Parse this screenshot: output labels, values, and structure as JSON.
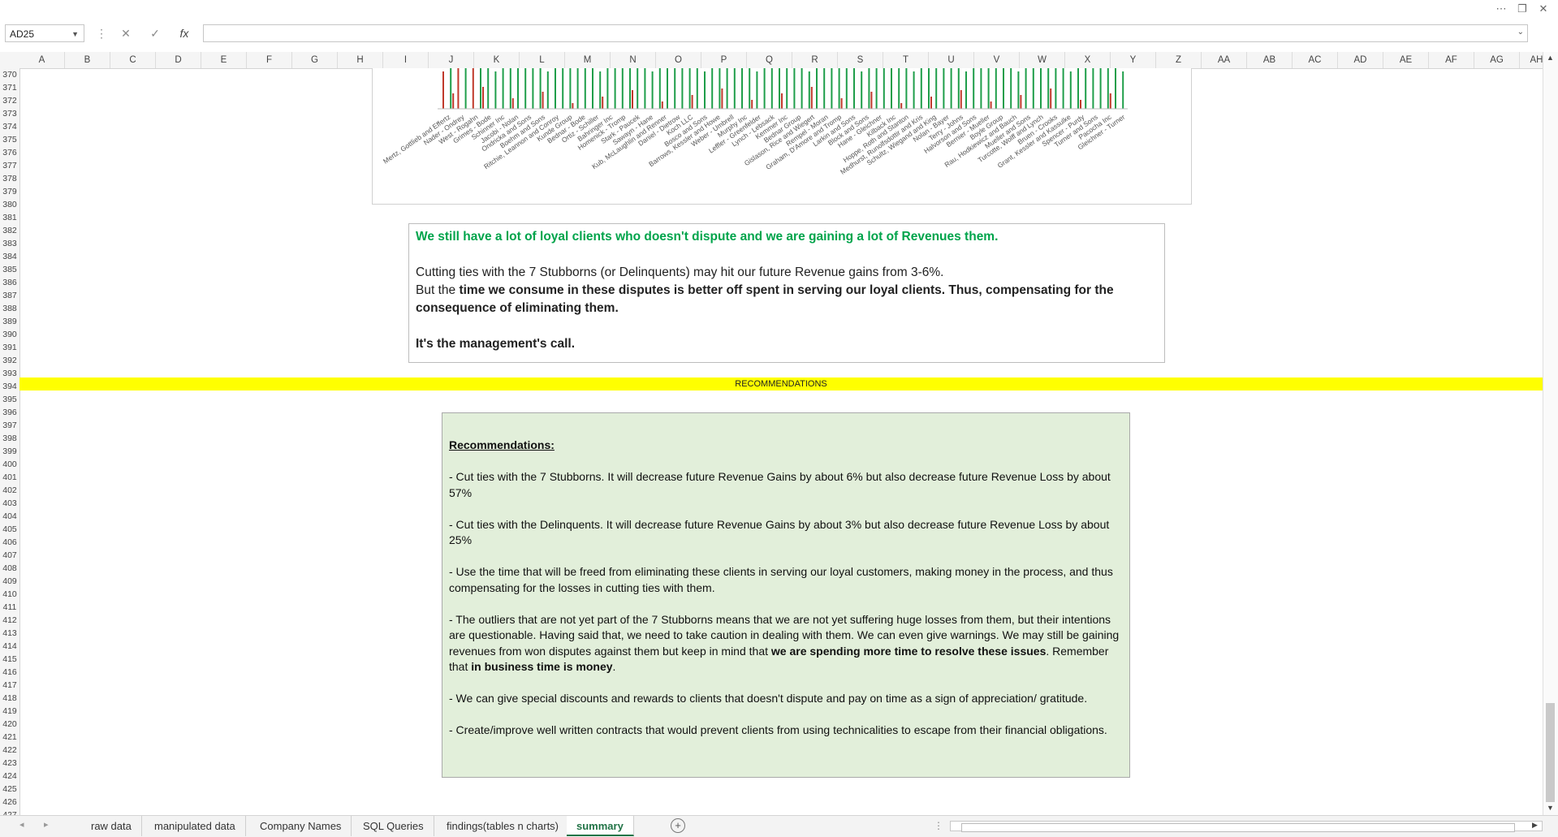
{
  "window": {
    "more_icon": "ellipsis-icon",
    "restore_icon": "restore-icon",
    "close_icon": "close-icon"
  },
  "formula_bar": {
    "name_box": "AD25",
    "formula": ""
  },
  "columns": [
    "A",
    "B",
    "C",
    "D",
    "E",
    "F",
    "G",
    "H",
    "I",
    "J",
    "K",
    "L",
    "M",
    "N",
    "O",
    "P",
    "Q",
    "R",
    "S",
    "T",
    "U",
    "V",
    "W",
    "X",
    "Y",
    "Z",
    "AA",
    "AB",
    "AC",
    "AD",
    "AE",
    "AF",
    "AG",
    "AH"
  ],
  "rows": [
    "370",
    "371",
    "372",
    "373",
    "374",
    "375",
    "376",
    "377",
    "378",
    "379",
    "380",
    "381",
    "382",
    "383",
    "384",
    "385",
    "386",
    "387",
    "388",
    "389",
    "390",
    "391",
    "392",
    "393",
    "394",
    "395",
    "396",
    "397",
    "398",
    "399",
    "400",
    "401",
    "402",
    "403",
    "404",
    "405",
    "406",
    "407",
    "408",
    "409",
    "410",
    "411",
    "412",
    "413",
    "414",
    "415",
    "416",
    "417",
    "418",
    "419",
    "420",
    "421",
    "422",
    "423",
    "424",
    "425",
    "426",
    "427"
  ],
  "chart": {
    "colors": {
      "gain": "#1f9e4a",
      "loss": "#c0392b"
    },
    "tick_labels": [
      "Mertz, Gottlieb and Effertz",
      "Nader - Ondrey",
      "West - Rogahn",
      "Grimes - Bode",
      "Schinner Inc",
      "Jacobi - Nolan",
      "Ondricka and Sons",
      "Boehm and Sons",
      "Ritchie, Leannon and Conroy",
      "Kunde Group",
      "Bednar - Bode",
      "Ortiz - Schiller",
      "Bahringer Inc",
      "Homenick - Tromp",
      "Stark - Paucek",
      "Sawayn - Hane",
      "Kub, McLaughlin and Renner",
      "Daniel - Dietrow",
      "Koch LLC",
      "Bosco and Sons",
      "Barrows, Kessler and Howe",
      "Weber - Umbrell",
      "Murphy Inc",
      "Leffler - Greenfelder",
      "Lynch - Lebsack",
      "Kemmer Inc",
      "Bednar Group",
      "Gislason, Rice and Wiegert",
      "Rempel - Moran",
      "Graham, D'Amore and Tromp",
      "Larkin and Sons",
      "Block and Sons",
      "Hane - Gleichner",
      "Kilback Inc",
      "Hoppe, Roth and Stanton",
      "Medhurst, Runolfsdottir and Kris",
      "Schultz, Wiegand and King",
      "Nolan - Bayer",
      "Terry - Johns",
      "Halvorson and Sons",
      "Bernier - Mueller",
      "Boyle Group",
      "Rau, Hodkiewicz and Bauch",
      "Mueller and Sons",
      "Turcotte, Wolff and Lynch",
      "Bruen - Crooks",
      "Grant, Kessler and Kassulke",
      "Spencer - Purdy",
      "Turner and Sons",
      "Pacocha Inc",
      "Gleichner - Turner"
    ]
  },
  "text_box": {
    "headline": "We still have a lot of loyal clients who doesn't dispute and we are gaining a lot of Revenues them.",
    "line1": "Cutting ties with the 7 Stubborns (or Delinquents) may hit our future Revenue gains from 3-6%.",
    "line2_start": "But the ",
    "line2_bold": "time we consume in these disputes is better off spent in serving our loyal clients. Thus, compensating for the consequence of eliminating them.",
    "line3": "It's the management's call."
  },
  "band": {
    "label": "RECOMMENDATIONS"
  },
  "recommendations": {
    "title": "Recommendations:",
    "r1": " - Cut ties with the 7 Stubborns. It will decrease future Revenue Gains by about 6% but also decrease future Revenue Loss by about 57%",
    "r2": " - Cut ties with the Delinquents. It will decrease future Revenue Gains by about 3% but also decrease future Revenue Loss by about 25%",
    "r3": " - Use the time that will be freed from eliminating these clients in serving our loyal customers, making money in the process, and thus  compensating for the losses in cutting ties with  them.",
    "r4_a": " - The outliers that are not yet part of the 7 Stubborns means that we are not yet suffering huge losses from them, but their intentions are questionable. Having said that, we need to take caution in dealing with them. We can even give warnings. We may still be gaining revenues from won disputes against them but keep in mind that ",
    "r4_b": "we are spending more time to resolve these issues",
    "r4_c": ". Remember that ",
    "r4_d": "in business time is money",
    "r4_e": ".",
    "r5": " - We can give special discounts and rewards to clients that doesn't dispute and pay on time as a sign of appreciation/ gratitude.",
    "r6": " - Create/improve well written contracts that would prevent clients from using technicalities to escape from their financial obligations."
  },
  "tabs": [
    "raw data",
    "manipulated data",
    "Company Names",
    "SQL Queries",
    "findings(tables n charts)",
    "summary"
  ],
  "active_tab": "summary"
}
